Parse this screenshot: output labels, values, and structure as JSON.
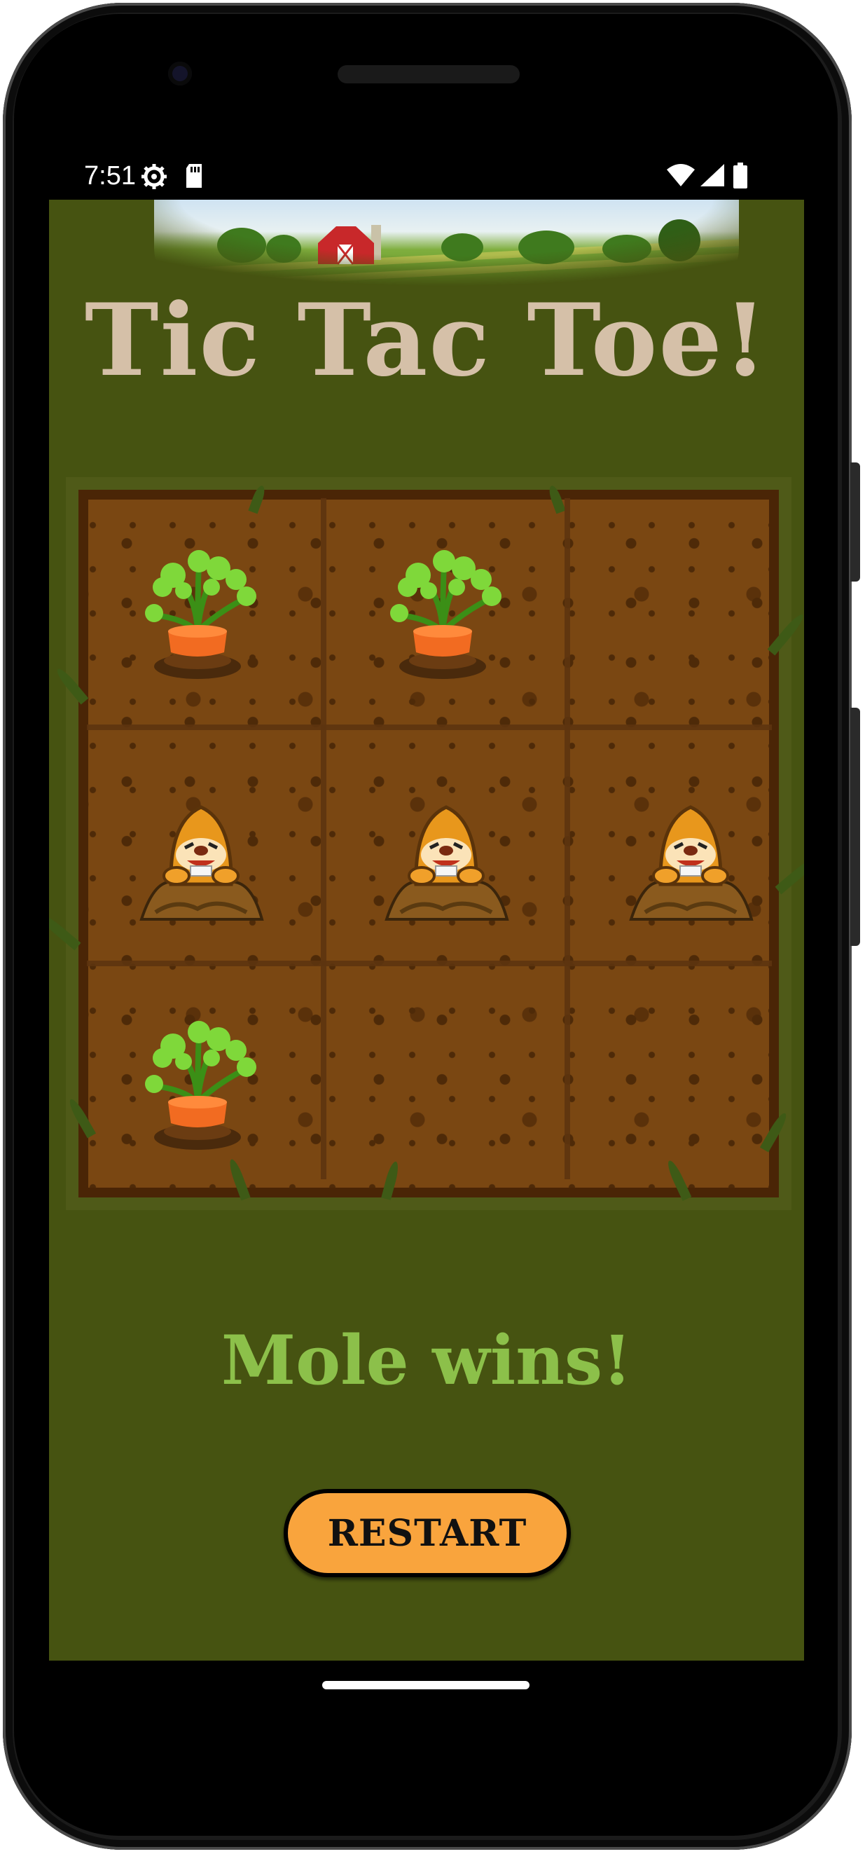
{
  "status_bar": {
    "time": "7:51",
    "left_icons": [
      "gear-icon",
      "sd-card-icon"
    ],
    "right_icons": [
      "wifi-icon",
      "cell-signal-icon",
      "battery-icon"
    ]
  },
  "app": {
    "title": "Tic Tac Toe!",
    "result_text": "Mole wins!",
    "restart_label": "RESTART",
    "colors": {
      "background": "#465311",
      "title": "#d5c0a8",
      "result": "#8cc04a",
      "button": "#f9a43d"
    }
  },
  "board": {
    "cells": [
      [
        "carrot",
        "carrot",
        ""
      ],
      [
        "mole",
        "mole",
        "mole"
      ],
      [
        "carrot",
        "",
        ""
      ]
    ]
  }
}
